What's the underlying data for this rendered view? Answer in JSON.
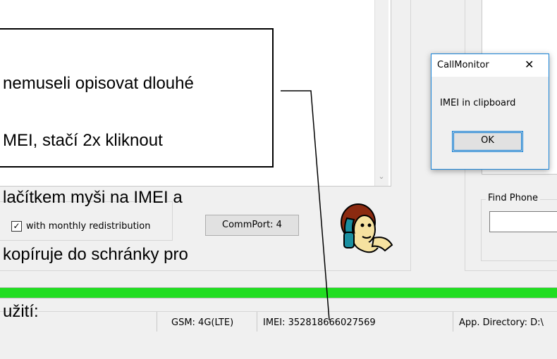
{
  "callout": {
    "lines": [
      "nemuseli opisovat dlouhé",
      "MEI, stačí 2x kliknout",
      "lačítkem myši na IMEI a",
      "kopíruje do schránky pro",
      "užití:"
    ]
  },
  "dialog": {
    "title": "CallMonitor",
    "message": "IMEI in clipboard",
    "ok_label": "OK",
    "close_glyph": "✕"
  },
  "options": {
    "redistribution_label": "with monthly redistribution",
    "redistribution_checked": true
  },
  "commport_button": "CommPort: 4",
  "find_phone": {
    "label": "Find Phone",
    "value": ""
  },
  "progress": {
    "fraction": 1.0,
    "color": "#22dd22"
  },
  "statusbar": {
    "gsm": "GSM: 4G(LTE)",
    "imei": "IMEI: 352818666027569",
    "app_dir": "App. Directory: D:\\"
  }
}
